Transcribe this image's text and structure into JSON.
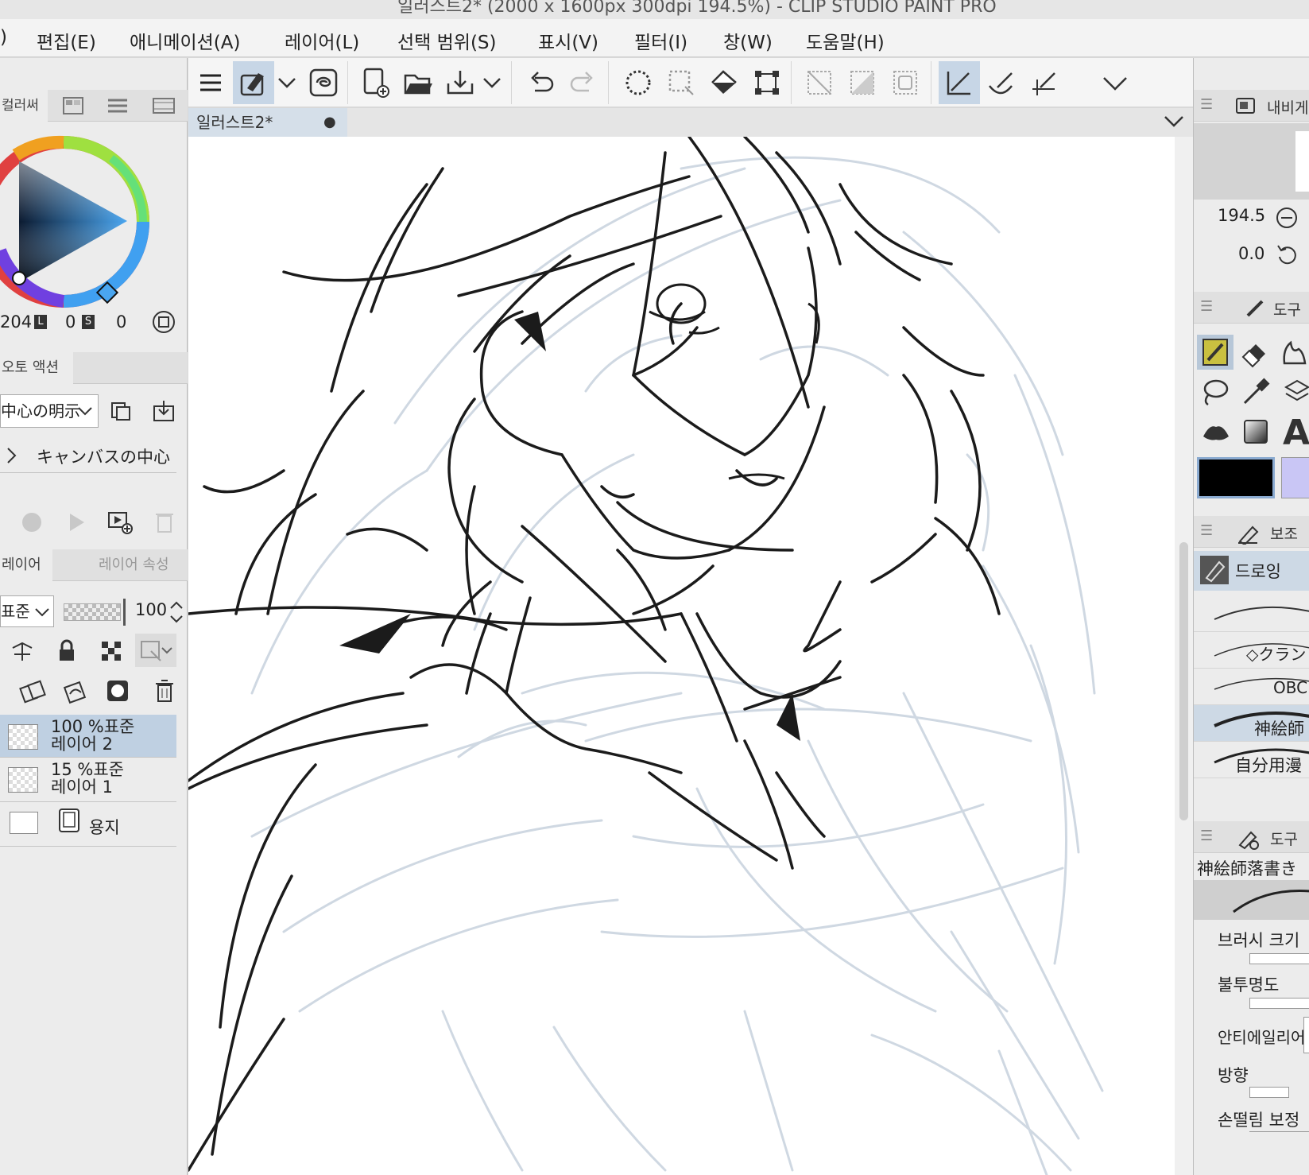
{
  "window": {
    "title": "일러스트2* (2000 x 1600px 300dpi 194.5%)  - CLIP STUDIO PAINT PRO"
  },
  "menu": [
    {
      "label": ")"
    },
    {
      "label": "편집(E)"
    },
    {
      "label": "애니메이션(A)"
    },
    {
      "label": "레이어(L)"
    },
    {
      "label": "선택 범위(S)"
    },
    {
      "label": "표시(V)"
    },
    {
      "label": "필터(I)"
    },
    {
      "label": "창(W)"
    },
    {
      "label": "도움말(H)"
    }
  ],
  "color_panel": {
    "tabs": [
      "컬러써"
    ],
    "values": {
      "h": "204",
      "l_badge": "L",
      "s_val": "0",
      "s_badge": "S",
      "v": "0"
    }
  },
  "auto_action": {
    "tab": "오토 액션",
    "set_name": "中心の明示",
    "item": "キャンバスの中心"
  },
  "layer_panel": {
    "tabs": [
      "레이어",
      "레이어 속성"
    ],
    "blend_mode": "표준",
    "opacity": "100",
    "layers": [
      {
        "line1": "100 %표준",
        "line2": "레이어 2",
        "selected": true
      },
      {
        "line1": "15 %표준",
        "line2": "레이어 1",
        "selected": false
      },
      {
        "line1": "",
        "line2": "용지",
        "selected": false
      }
    ]
  },
  "document": {
    "tab_label": "일러스트2*"
  },
  "navigator": {
    "tab": "내비게",
    "zoom": "194.5",
    "rotation": "0.0"
  },
  "tool_panel": {
    "tab": "도구"
  },
  "sub_tool_panel": {
    "tab": "보조",
    "group": "드로잉",
    "brushes": [
      "",
      "◇クラン",
      "OBC",
      "神絵師",
      "自分用漫"
    ]
  },
  "tool_property": {
    "tab": "도구",
    "brush_name": "神絵師落書き",
    "props": [
      "브러시 크기",
      "불투명도",
      "안티에일리어",
      "방향",
      "손떨림 보정"
    ]
  },
  "colors": {
    "main_color": "#000000",
    "sub_color": "#c9c6f5",
    "selection": "#c7d6e6"
  }
}
